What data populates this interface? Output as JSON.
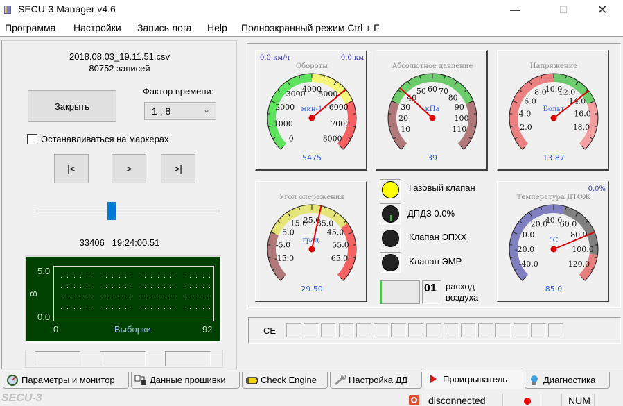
{
  "window": {
    "title": "SECU-3 Manager v4.6",
    "controls": {
      "minimize": "—",
      "maximize": "☐",
      "close": "✕"
    }
  },
  "menu": [
    "Программа",
    "Настройки",
    "Запись лога",
    "Help",
    "Полноэкранный режим Ctrl + F"
  ],
  "player": {
    "file_name": "2018.08.03_19.11.51.csv",
    "records": "80752 записей",
    "close_label": "Закрыть",
    "time_factor_label": "Фактор времени:",
    "time_factor_value": "1 : 8",
    "stop_on_markers_label": "Останавливаться на маркерах",
    "stop_on_markers_checked": false,
    "nav": {
      "first": "|<",
      "play": ">",
      "last": ">|"
    },
    "slider_fraction": 0.41,
    "position_record": "33406",
    "position_time": "19:24:00.51",
    "scope": {
      "y_max": "5.0",
      "y_min": "0.0",
      "y_unit": "В",
      "x_min": "0",
      "x_max": "92",
      "x_label": "Выборки",
      "bg_color": "#004000"
    }
  },
  "gauges": [
    {
      "id": "rpm",
      "title": "Обороты",
      "unit": "мин-1",
      "value_text": "5475",
      "value": 5475,
      "min": 0,
      "max": 8000,
      "labels": [
        "0",
        "1000",
        "2000",
        "3000",
        "4000",
        "5000",
        "6000",
        "7000",
        "8000"
      ],
      "zones": [
        {
          "from": 0,
          "to": 4000,
          "color": "#5ee35e"
        },
        {
          "from": 4000,
          "to": 6000,
          "color": "#f5f57a"
        },
        {
          "from": 6000,
          "to": 8000,
          "color": "#f56262"
        }
      ],
      "top_left": "0.0 км/ч",
      "top_right": "0.0 км"
    },
    {
      "id": "map",
      "title": "Абсолютное давление",
      "unit": "кПа",
      "value_text": "39",
      "value": 39,
      "min": 0,
      "max": 120,
      "labels": [
        "10",
        "20",
        "30",
        "40",
        "50",
        "60",
        "70",
        "80",
        "90",
        "100",
        "110"
      ],
      "label_values": [
        10,
        20,
        30,
        40,
        50,
        60,
        70,
        80,
        90,
        100,
        110
      ],
      "zones": [
        {
          "from": 0,
          "to": 30,
          "color": "#b07878"
        },
        {
          "from": 30,
          "to": 90,
          "color": "#6ccc6c"
        },
        {
          "from": 90,
          "to": 120,
          "color": "#b07878"
        }
      ]
    },
    {
      "id": "voltage",
      "title": "Напряжение",
      "unit": "Вольт",
      "value_text": "13.87",
      "value": 13.87,
      "min": 0,
      "max": 20,
      "labels": [
        "2.0",
        "4.0",
        "6.0",
        "8.0",
        "10.0",
        "12.0",
        "14.0",
        "16.0",
        "18.0"
      ],
      "label_values": [
        2,
        4,
        6,
        8,
        10,
        12,
        14,
        16,
        18
      ],
      "zones": [
        {
          "from": 0,
          "to": 10,
          "color": "#ec8080"
        },
        {
          "from": 10,
          "to": 15,
          "color": "#6ccc6c"
        },
        {
          "from": 15,
          "to": 20,
          "color": "#f5a0a0"
        }
      ]
    },
    {
      "id": "advance",
      "title": "Угол опережения",
      "unit": "град.",
      "value_text": "29.50",
      "value": 29.5,
      "min": -25,
      "max": 75,
      "labels": [
        "-15.0",
        "-5.0",
        "5.0",
        "15.0",
        "25.0",
        "35.0",
        "45.0",
        "55.0",
        "65.0"
      ],
      "label_values": [
        -15,
        -5,
        5,
        15,
        25,
        35,
        45,
        55,
        65
      ],
      "zones": [
        {
          "from": -25,
          "to": 0,
          "color": "#b07878"
        },
        {
          "from": 0,
          "to": 45,
          "color": "#e5e57a"
        },
        {
          "from": 45,
          "to": 75,
          "color": "#f56262"
        }
      ]
    },
    {
      "id": "coolant",
      "title": "Температура ДТОЖ",
      "unit": "°C",
      "value_text": "85.0",
      "value": 85,
      "min": -50,
      "max": 130,
      "labels": [
        "-40.0",
        "-20.0",
        "0.0",
        "20.0",
        "40.0",
        "60.0",
        "80.0",
        "100.0",
        "120.0"
      ],
      "label_values": [
        -40,
        -20,
        0,
        20,
        40,
        60,
        80,
        100,
        120
      ],
      "zones": [
        {
          "from": -50,
          "to": 50,
          "color": "#8080c0"
        },
        {
          "from": 50,
          "to": 105,
          "color": "#808080"
        },
        {
          "from": 105,
          "to": 130,
          "color": "#e88080"
        }
      ],
      "top_right": "0.0%"
    }
  ],
  "indicators": [
    {
      "label": "Газовый клапан",
      "state": "on",
      "color": "#ffff00"
    },
    {
      "label": "ДПДЗ  0.0%",
      "state": "off",
      "color": "#222222"
    },
    {
      "label": "Клапан ЭПХХ",
      "state": "off",
      "color": "#222222"
    },
    {
      "label": "Клапан ЭМР",
      "state": "off",
      "color": "#222222"
    }
  ],
  "air_flow": {
    "value": "01",
    "label_line1": "расход",
    "label_line2": "воздуха"
  },
  "ce": {
    "label": "CE",
    "cells": 16
  },
  "tabs": [
    {
      "label": "Параметры и монитор",
      "icon": "gauge-icon",
      "active": false
    },
    {
      "label": "Данные прошивки",
      "icon": "firmware-data-icon",
      "active": false
    },
    {
      "label": "Check Engine",
      "icon": "check-engine-icon",
      "active": false
    },
    {
      "label": "Настройка ДД",
      "icon": "wrench-icon",
      "active": false
    },
    {
      "label": "Проигрыватель",
      "icon": "play-icon",
      "active": true
    },
    {
      "label": "Диагностика",
      "icon": "lightbulb-icon",
      "active": false
    }
  ],
  "status": {
    "brand": "SECU-3",
    "connection": "disconnected",
    "num": "NUM",
    "colors": {
      "connection_icon": "#e05030",
      "dot": "#ee0000"
    }
  }
}
